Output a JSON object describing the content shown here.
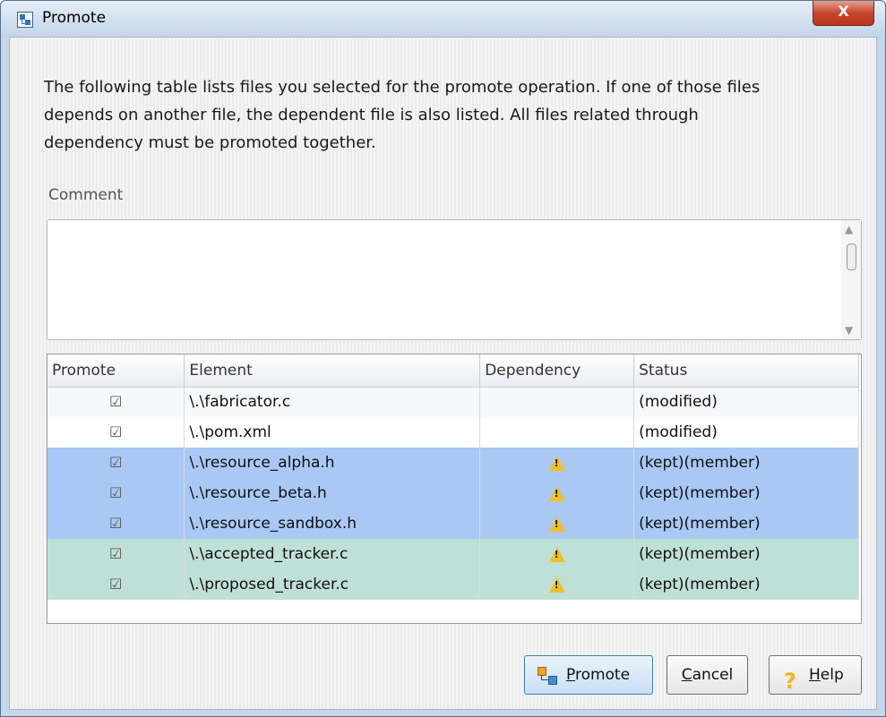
{
  "window": {
    "title": "Promote",
    "close_label": "X"
  },
  "description": "The following table lists files you selected for the promote operation. If one of those files depends on another file, the dependent file is also listed. All files related through dependency must be promoted together.",
  "comment": {
    "label": "Comment",
    "value": ""
  },
  "table": {
    "headers": [
      "Promote",
      "Element",
      "Dependency",
      "Status"
    ],
    "rows": [
      {
        "checked": true,
        "element": "\\.\\fabricator.c",
        "dependency_warning": false,
        "status": "(modified)"
      },
      {
        "checked": true,
        "element": "\\.\\pom.xml",
        "dependency_warning": false,
        "status": "(modified)"
      },
      {
        "checked": true,
        "element": "\\.\\resource_alpha.h",
        "dependency_warning": true,
        "status": "(kept)(member)"
      },
      {
        "checked": true,
        "element": "\\.\\resource_beta.h",
        "dependency_warning": true,
        "status": "(kept)(member)"
      },
      {
        "checked": true,
        "element": "\\.\\resource_sandbox.h",
        "dependency_warning": true,
        "status": "(kept)(member)"
      },
      {
        "checked": true,
        "element": "\\.\\accepted_tracker.c",
        "dependency_warning": true,
        "status": "(kept)(member)"
      },
      {
        "checked": true,
        "element": "\\.\\proposed_tracker.c",
        "dependency_warning": true,
        "status": "(kept)(member)"
      }
    ]
  },
  "buttons": {
    "promote": {
      "first": "P",
      "rest": "romote"
    },
    "cancel": {
      "first": "C",
      "rest": "ancel"
    },
    "help": {
      "first": "H",
      "rest": "elp"
    }
  },
  "colors": {
    "row_blue": "#a9c8f4",
    "row_green": "#bfe0d7",
    "warning": "#f0c02a"
  }
}
